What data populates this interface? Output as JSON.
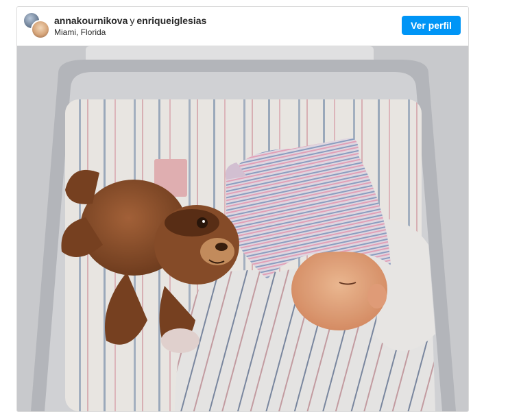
{
  "post": {
    "user1": "annakournikova",
    "conjunction": "y",
    "user2": "enriqueiglesias",
    "location": "Miami, Florida",
    "profile_button": "Ver perfil"
  },
  "photo": {
    "subject": "newborn-baby-with-sloth-plush"
  },
  "colors": {
    "button": "#0095f6",
    "text": "#262626",
    "border": "#dbdbdb"
  }
}
